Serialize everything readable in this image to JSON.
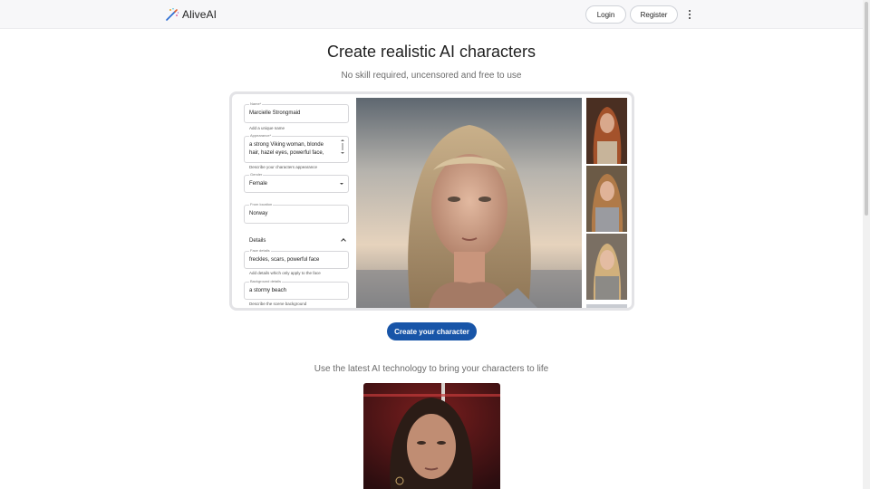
{
  "header": {
    "brand": "AliveAI",
    "logo_icon": "magic-wand-icon",
    "login_label": "Login",
    "register_label": "Register",
    "menu_icon": "more-vertical-icon"
  },
  "hero": {
    "title": "Create realistic AI characters",
    "subtitle": "No skill required, uncensored and free to use"
  },
  "form": {
    "name": {
      "label": "Name*",
      "value": "Marcielle Strongmaid",
      "helper": "Add a unique name"
    },
    "appearance": {
      "label": "Appearance*",
      "value_line1": "a strong Viking woman, blonde",
      "value_line2": "hair, hazel eyes, powerful face,",
      "helper": "Describe your characters appearance"
    },
    "gender": {
      "label": "Gender",
      "value": "Female"
    },
    "location": {
      "label": "From location",
      "value": "Norway"
    },
    "details_section": "Details",
    "face": {
      "label": "Face details",
      "value": "freckles, scars, powerful face",
      "helper": "Add details which only apply to the face"
    },
    "background": {
      "label": "Background details",
      "value": "a stormy beach",
      "helper": "Describe the scene background"
    }
  },
  "cta_label": "Create your character",
  "section2": {
    "subtitle": "Use the latest AI technology to bring your characters to life"
  },
  "colors": {
    "primary": "#1855a8",
    "header_bg": "#f7f7f9",
    "title": "#1f1f1f",
    "muted": "#6b6b6b"
  }
}
